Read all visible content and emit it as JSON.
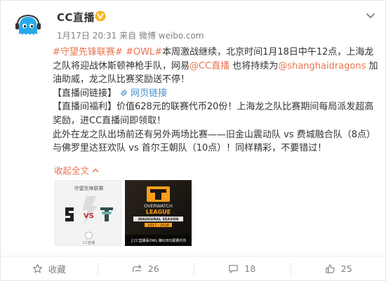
{
  "post": {
    "author": "CC直播",
    "time": "1月17日 20:31",
    "source": "来自 微博 weibo.com",
    "paragraphs": [
      [
        {
          "t": "link",
          "v": "#守望先锋联赛#"
        },
        {
          "t": "text",
          "v": " "
        },
        {
          "t": "link",
          "v": "#OWL#"
        },
        {
          "t": "text",
          "v": "本周激战继续，北京时间1月18日中午12点，上海龙之队将迎战休斯顿神枪手队，网易"
        },
        {
          "t": "link",
          "v": "@CC直播"
        },
        {
          "t": "text",
          "v": " 也将持续为"
        },
        {
          "t": "link",
          "v": "@shanghaidragons"
        },
        {
          "t": "text",
          "v": " 加油助威，龙之队比赛奖励送不停！"
        }
      ],
      [
        {
          "t": "text",
          "v": "【直播间链接】 "
        },
        {
          "t": "weblink",
          "v": "网页链接"
        }
      ],
      [
        {
          "t": "text",
          "v": "【直播间福利】价值628元的联赛代币20份！上海龙之队比赛期间每局派发超高奖励，进CC直播间即领取！"
        }
      ],
      [
        {
          "t": "text",
          "v": "此外在龙之队出场前还有另外两场比赛——旧金山震动队 vs 费城融合队（8点）与佛罗里达狂欢队 vs 首尔王朝队（10点）！同样精彩，不要错过！"
        }
      ]
    ],
    "collapse_label": "收起全文",
    "images": {
      "img1": {
        "header": "守望先锋联赛",
        "vs": "VS",
        "footer": "CC直播"
      },
      "img2": {
        "brand": "OVERWATCH",
        "league": "LEAGUE",
        "season": "INAUGURAL SEASON",
        "years": "2017 - 2018",
        "bottom": "上CC直播看OWL 赚628元联赛代币"
      }
    }
  },
  "actions": {
    "favorite": "收藏",
    "repost": "26",
    "comment": "18",
    "like": "25"
  },
  "colors": {
    "link": "#eb7350",
    "weblink": "#4c8fcc",
    "text": "#333333",
    "muted": "#808080",
    "vbadge": "#f6b51f"
  }
}
